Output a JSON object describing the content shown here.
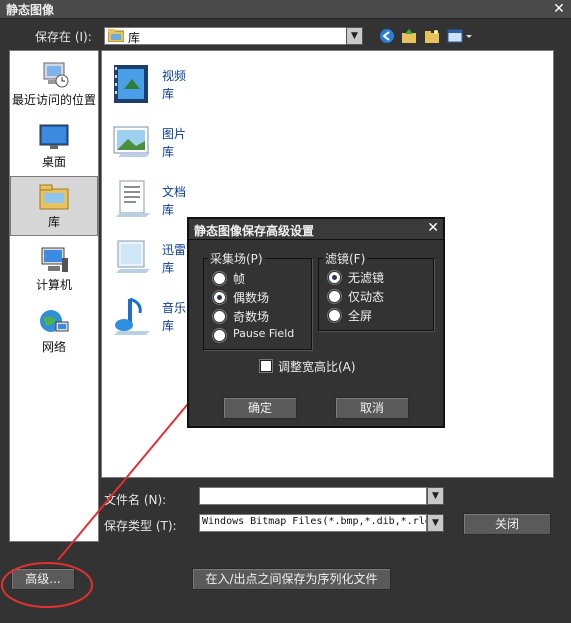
{
  "window": {
    "title": "静态图像",
    "close": "✕"
  },
  "save_in": {
    "label": "保存在 (I):",
    "value": "库"
  },
  "places": [
    {
      "label": "最近访问的位置",
      "icon": "recent-places-icon"
    },
    {
      "label": "桌面",
      "icon": "desktop-icon"
    },
    {
      "label": "库",
      "icon": "library-icon",
      "selected": true
    },
    {
      "label": "计算机",
      "icon": "computer-icon"
    },
    {
      "label": "网络",
      "icon": "network-icon"
    }
  ],
  "libraries": [
    {
      "line1": "视频",
      "line2": "库",
      "icon": "video-library-icon"
    },
    {
      "line1": "图片",
      "line2": "库",
      "icon": "picture-library-icon"
    },
    {
      "line1": "文档",
      "line2": "库",
      "icon": "document-library-icon"
    },
    {
      "line1": "迅雷下",
      "line2": "库",
      "icon": "download-library-icon"
    },
    {
      "line1": "音乐",
      "line2": "库",
      "icon": "music-library-icon"
    }
  ],
  "file_name": {
    "label": "文件名 (N):",
    "value": ""
  },
  "save_type": {
    "label": "保存类型 (T):",
    "value": "Windows Bitmap Files(*.bmp,*.dib,*.rle)"
  },
  "buttons": {
    "close": "关闭",
    "advanced": "高级...",
    "save_sequence": "在入/出点之间保存为序列化文件"
  },
  "dialog": {
    "title": "静态图像保存高级设置",
    "close": "✕",
    "field_group": {
      "title": "采集场(P)",
      "options": [
        "帧",
        "偶数场",
        "奇数场",
        "Pause Field"
      ],
      "selected": 1
    },
    "filter_group": {
      "title": "滤镜(F)",
      "options": [
        "无滤镜",
        "仅动态",
        "全屏"
      ],
      "selected": 0
    },
    "aspect_label": "调整宽高比(A)",
    "aspect_checked": false,
    "ok": "确定",
    "cancel": "取消"
  },
  "annotation_color": "#e03030"
}
